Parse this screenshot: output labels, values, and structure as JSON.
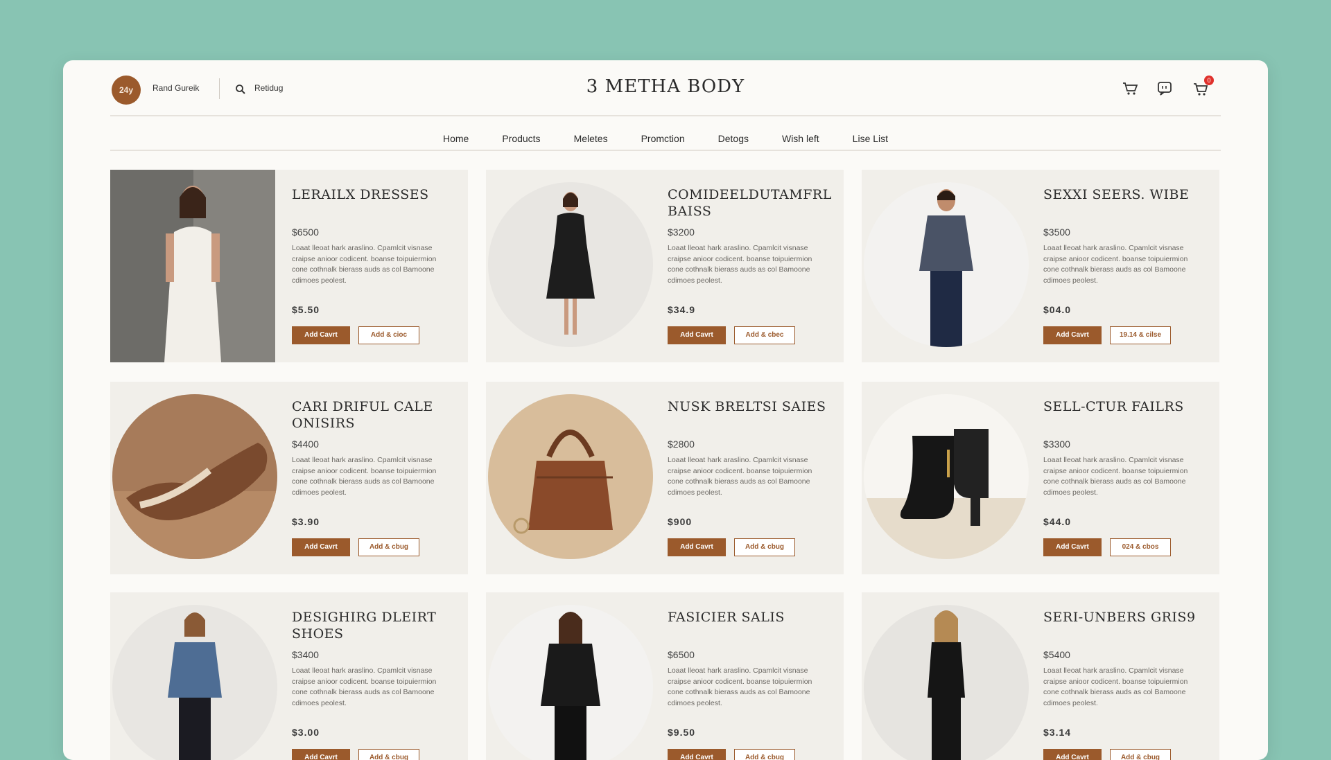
{
  "header": {
    "logo_text": "24y",
    "brand_name": "Rand Gureik",
    "search_label": "Retidug",
    "site_title": "3 METHA BODY",
    "cart_count": "0",
    "icons": [
      "shopping-cart-icon",
      "chat-icon",
      "basket-icon"
    ]
  },
  "nav": {
    "items": [
      "Home",
      "Products",
      "Meletes",
      "Promction",
      "Detogs",
      "Wish left",
      "Lise List"
    ]
  },
  "products": [
    {
      "title": "LERAILX DRESSES",
      "price": "$6500",
      "sale": "$5.50",
      "desc": "Loaat lleoat hark araslino. Cpamlcit visnase craipse anioor codicent. boanse toipuiermion cone cothnalk bierass auds as col Bamoone cdimoes peolest.",
      "add_label": "Add Cavrt",
      "secondary_label": "Add & cioc"
    },
    {
      "title": "COMIDEELDUTAMFRL BAISS",
      "price": "$3200",
      "sale": "$34.9",
      "desc": "Loaat lleoat hark araslino. Cpamlcit visnase craipse anioor codicent. boanse toipuiermion cone cothnalk bierass auds as col Bamoone cdimoes peolest.",
      "add_label": "Add Cavrt",
      "secondary_label": "Add & cbec"
    },
    {
      "title": "SEXXI SEERS. WIBE",
      "price": "$3500",
      "sale": "$04.0",
      "desc": "Loaat lleoat hark araslino. Cpamlcit visnase craipse anioor codicent. boanse toipuiermion cone cothnalk bierass auds as col Bamoone cdimoes peolest.",
      "add_label": "Add Cavrt",
      "secondary_label": "19.14 & cilse"
    },
    {
      "title": "CARI DRIFUL CALE ONISIRS",
      "price": "$4400",
      "sale": "$3.90",
      "desc": "Loaat lleoat hark araslino. Cpamlcit visnase craipse anioor codicent. boanse toipuiermion cone cothnalk bierass auds as col Bamoone cdimoes peolest.",
      "add_label": "Add Cavrt",
      "secondary_label": "Add & cbug"
    },
    {
      "title": "NUSK BRELTSI SAIES",
      "price": "$2800",
      "sale": "$900",
      "desc": "Loaat lleoat hark araslino. Cpamlcit visnase craipse anioor codicent. boanse toipuiermion cone cothnalk bierass auds as col Bamoone cdimoes peolest.",
      "add_label": "Add Cavrt",
      "secondary_label": "Add & cbug"
    },
    {
      "title": "SELL-CTUR FAILRS",
      "price": "$3300",
      "sale": "$44.0",
      "desc": "Loaat lleoat hark araslino. Cpamlcit visnase craipse anioor codicent. boanse toipuiermion cone cothnalk bierass auds as col Bamoone cdimoes peolest.",
      "add_label": "Add Cavrt",
      "secondary_label": "024 & cbos"
    },
    {
      "title": "DESIGHIRG DLEIRT SHOES",
      "price": "$3400",
      "sale": "$3.00",
      "desc": "Loaat lleoat hark araslino. Cpamlcit visnase craipse anioor codicent. boanse toipuiermion cone cothnalk bierass auds as col Bamoone cdimoes peolest.",
      "add_label": "Add Cavrt",
      "secondary_label": "Add & cbug"
    },
    {
      "title": "FASICIER SALIS",
      "price": "$6500",
      "sale": "$9.50",
      "desc": "Loaat lleoat hark araslino. Cpamlcit visnase craipse anioor codicent. boanse toipuiermion cone cothnalk bierass auds as col Bamoone cdimoes peolest.",
      "add_label": "Add Cavrt",
      "secondary_label": "Add & cbug"
    },
    {
      "title": "SERI-UNBERS GRIS9",
      "price": "$5400",
      "sale": "$3.14",
      "desc": "Loaat lleoat hark araslino. Cpamlcit visnase craipse anioor codicent. boanse toipuiermion cone cothnalk bierass auds as col Bamoone cdimoes peolest.",
      "add_label": "Add Cavrt",
      "secondary_label": "Add & cbug"
    }
  ],
  "colors": {
    "background": "#88c4b3",
    "accent": "#9b5a2c",
    "card": "#f1efea",
    "badge": "#e0312c"
  }
}
